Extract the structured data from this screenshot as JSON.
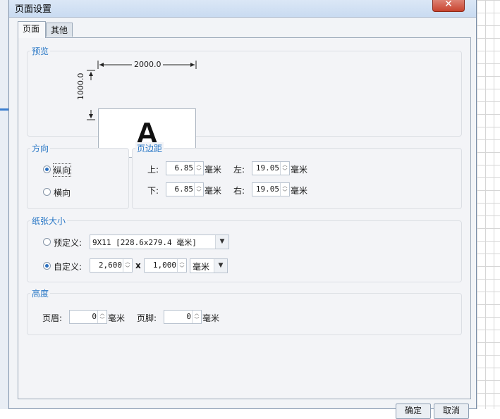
{
  "dialog": {
    "title": "页面设置",
    "close_glyph": "✕"
  },
  "tabs": [
    {
      "label": "页面"
    },
    {
      "label": "其他"
    }
  ],
  "preview": {
    "group_title": "预览",
    "width_label": "2000.0",
    "height_label": "1000.0",
    "sample_letter": "A"
  },
  "orientation": {
    "group_title": "方向",
    "portrait_label": "纵向",
    "landscape_label": "横向",
    "selected": "portrait"
  },
  "margins": {
    "group_title": "页边距",
    "top_label": "上:",
    "top_value": "6.85",
    "bottom_label": "下:",
    "bottom_value": "6.85",
    "left_label": "左:",
    "left_value": "19.05",
    "right_label": "右:",
    "right_value": "19.05",
    "unit": "毫米"
  },
  "paper_size": {
    "group_title": "纸张大小",
    "predefined_label": "预定义:",
    "predefined_value": "9X11 [228.6x279.4 毫米]",
    "custom_label": "自定义:",
    "custom_width": "2,600",
    "times": "x",
    "custom_height": "1,000",
    "unit": "毫米",
    "selected": "custom"
  },
  "height_group": {
    "group_title": "高度",
    "header_label": "页眉:",
    "header_value": "0",
    "footer_label": "页脚:",
    "footer_value": "0",
    "unit": "毫米"
  },
  "buttons": {
    "ok_label": "确定",
    "cancel_label": "取消"
  },
  "colors": {
    "group_title": "#2a78c6",
    "radio_selected": "#2a6fc0"
  }
}
